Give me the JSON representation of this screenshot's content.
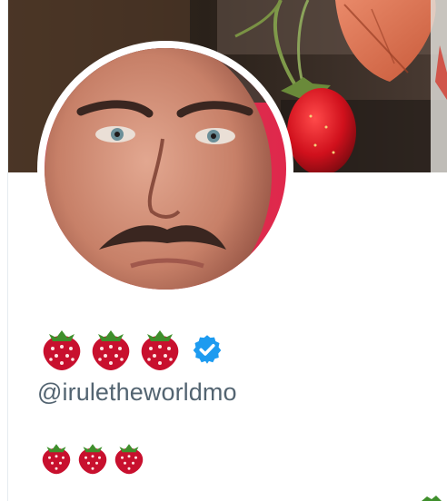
{
  "profile": {
    "display_name_emojis": [
      "strawberry",
      "strawberry",
      "strawberry"
    ],
    "verified": true,
    "verified_icon": "verified-badge-icon",
    "handle": "@iruletheworldmo",
    "bio_emojis": [
      "strawberry",
      "strawberry",
      "strawberry"
    ]
  },
  "colors": {
    "verified_blue": "#1d9bf0",
    "handle_gray": "#536471",
    "strawberry_red": "#c8102e",
    "leaf_green": "#3f8f2c"
  }
}
